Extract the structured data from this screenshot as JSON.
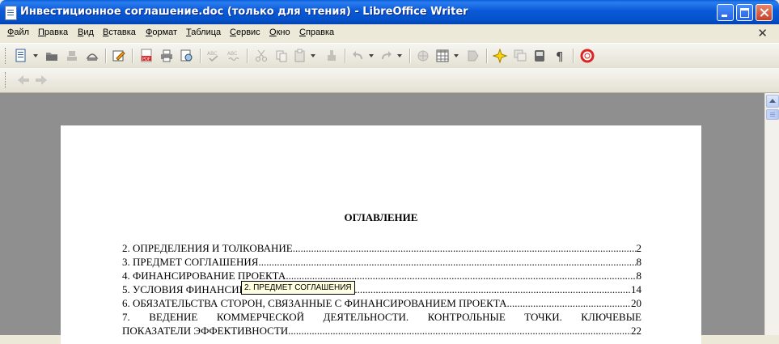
{
  "window": {
    "title": "Инвестиционное соглашение.doc (только для чтения) - LibreOffice Writer"
  },
  "menu": [
    {
      "key": "Ф",
      "rest": "айл"
    },
    {
      "key": "П",
      "rest": "равка"
    },
    {
      "key": "В",
      "rest": "ид"
    },
    {
      "key": "В",
      "rest": "ставка"
    },
    {
      "key": "Ф",
      "rest": "ормат"
    },
    {
      "key": "Т",
      "rest": "аблица"
    },
    {
      "key": "С",
      "rest": "ервис"
    },
    {
      "key": "О",
      "rest": "кно"
    },
    {
      "key": "С",
      "rest": "правка"
    }
  ],
  "document": {
    "toc_heading": "ОГЛАВЛЕНИЕ",
    "toc": [
      {
        "title": "2. ОПРЕДЕЛЕНИЯ И ТОЛКОВАНИЕ",
        "page": "2"
      },
      {
        "title": "3. ПРЕДМЕТ СОГЛАШЕНИЯ",
        "page": "8"
      },
      {
        "title": "4. ФИНАНСИРОВАНИЕ ПРОЕКТА",
        "page": "8"
      },
      {
        "title": "5. УСЛОВИЯ ФИНАНСИРОВАНИЯ",
        "page": "14"
      },
      {
        "title": "6. ОБЯЗАТЕЛЬСТВА СТОРОН, СВЯЗАННЫЕ С ФИНАНСИРОВАНИЕМ ПРОЕКТА",
        "page": "20"
      }
    ],
    "toc_multiline": {
      "line1": "7. ВЕДЕНИЕ КОММЕРЧЕСКОЙ ДЕЯТЕЛЬНОСТИ. КОНТРОЛЬНЫЕ ТОЧКИ. КЛЮЧЕВЫЕ",
      "line2": "ПОКАЗАТЕЛИ ЭФФЕКТИВНОСТИ",
      "page": "22"
    }
  },
  "tooltip": "2. ПРЕДМЕТ СОГЛАШЕНИЯ",
  "toolbar_icons": [
    "new-document",
    "open",
    "save",
    "export",
    "email",
    "edit-file",
    "export-pdf",
    "print",
    "print-preview",
    "spellcheck",
    "autospellcheck",
    "cut",
    "copy",
    "paste",
    "clone-formatting",
    "undo",
    "redo",
    "hyperlink",
    "table",
    "show-draw-functions",
    "navigator",
    "gallery",
    "data-sources",
    "formatting-marks",
    "help"
  ],
  "colors": {
    "titlebar": "#0a5ed8",
    "workspace": "#8f8f8f",
    "tooltip": "#ffffe1"
  }
}
